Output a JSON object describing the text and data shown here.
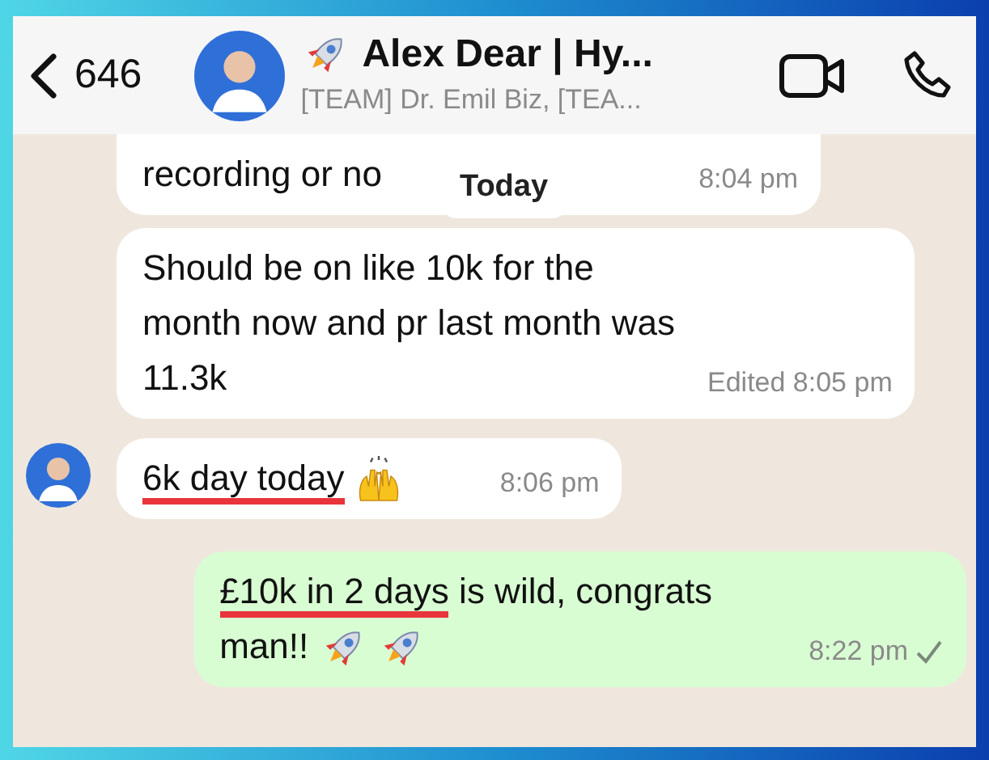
{
  "header": {
    "back_count": "646",
    "title": "Alex Dear | Hy...",
    "subtitle": "[TEAM] Dr. Emil Biz, [TEA..."
  },
  "date_chip": "Today",
  "messages": [
    {
      "outgoing": false,
      "avatar": false,
      "parts": [
        {
          "kind": "text",
          "text": "recording or no",
          "underlined": false
        }
      ],
      "time": "8:04 pm"
    },
    {
      "outgoing": false,
      "avatar": false,
      "parts": [
        {
          "kind": "text",
          "text": "Should be on like 10k for the month now and pr last month was 11.3k",
          "underlined": false
        }
      ],
      "time": "Edited 8:05 pm"
    },
    {
      "outgoing": false,
      "avatar": true,
      "parts": [
        {
          "kind": "text",
          "text": "6k day today",
          "underlined": true
        },
        {
          "kind": "hands"
        }
      ],
      "time": "8:06 pm"
    },
    {
      "outgoing": true,
      "avatar": false,
      "parts": [
        {
          "kind": "text",
          "text": "£10k in 2 days",
          "underlined": true
        },
        {
          "kind": "text",
          "text": " is wild, congrats man!!",
          "underlined": false
        },
        {
          "kind": "rocket"
        },
        {
          "kind": "rocket"
        }
      ],
      "time": "8:22 pm",
      "sent": true
    }
  ]
}
